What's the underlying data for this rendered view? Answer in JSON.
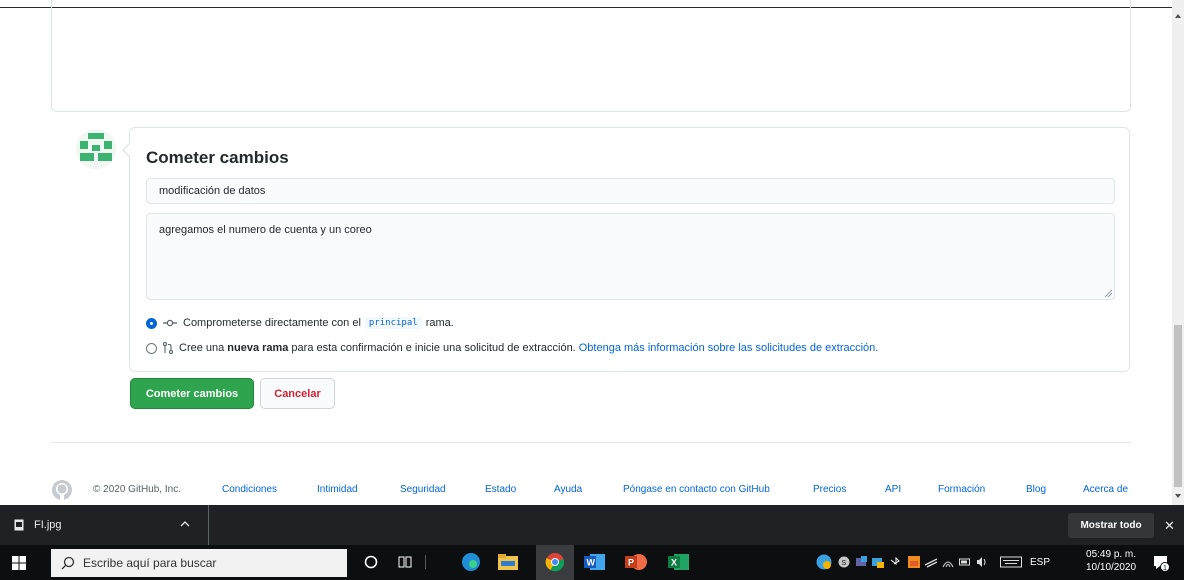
{
  "commit": {
    "title": "Cometer cambios",
    "summary_value": "modificación de datos",
    "description_value": "agregamos el numero de cuenta y un coreo",
    "option_direct": {
      "prefix": "Comprometerse directamente con el",
      "branch": "principal",
      "suffix": "rama."
    },
    "option_new_branch": {
      "prefix": "Cree una",
      "bold": "nueva rama",
      "middle": "para esta confirmación e inicie una solicitud de extracción.",
      "link": "Obtenga más información sobre las solicitudes de extracción."
    },
    "submit_label": "Cometer cambios",
    "cancel_label": "Cancelar"
  },
  "footer": {
    "copyright": "© 2020 GitHub, Inc.",
    "links": [
      "Condiciones",
      "Intimidad",
      "Seguridad",
      "Estado",
      "Ayuda",
      "Póngase en contacto con GitHub",
      "Precios",
      "API",
      "Formación",
      "Blog",
      "Acerca de"
    ]
  },
  "download_bar": {
    "file_name": "FI.jpg",
    "show_all_label": "Mostrar todo",
    "close_glyph": "✕"
  },
  "taskbar": {
    "search_placeholder": "Escribe aquí para buscar",
    "language": "ESP",
    "time": "05:49 p. m.",
    "date": "10/10/2020",
    "notification_count": "1"
  },
  "icons": {
    "branch": "git-commit-icon",
    "pull_request": "pull-request-icon",
    "logo": "github-logo-icon"
  },
  "colors": {
    "primary_button": "#2ea44f",
    "cancel_text": "#cb2431",
    "link": "#0366d6",
    "radio_checked": "#0366d6",
    "download_bar": "#202124",
    "taskbar": "#0c0e10"
  }
}
